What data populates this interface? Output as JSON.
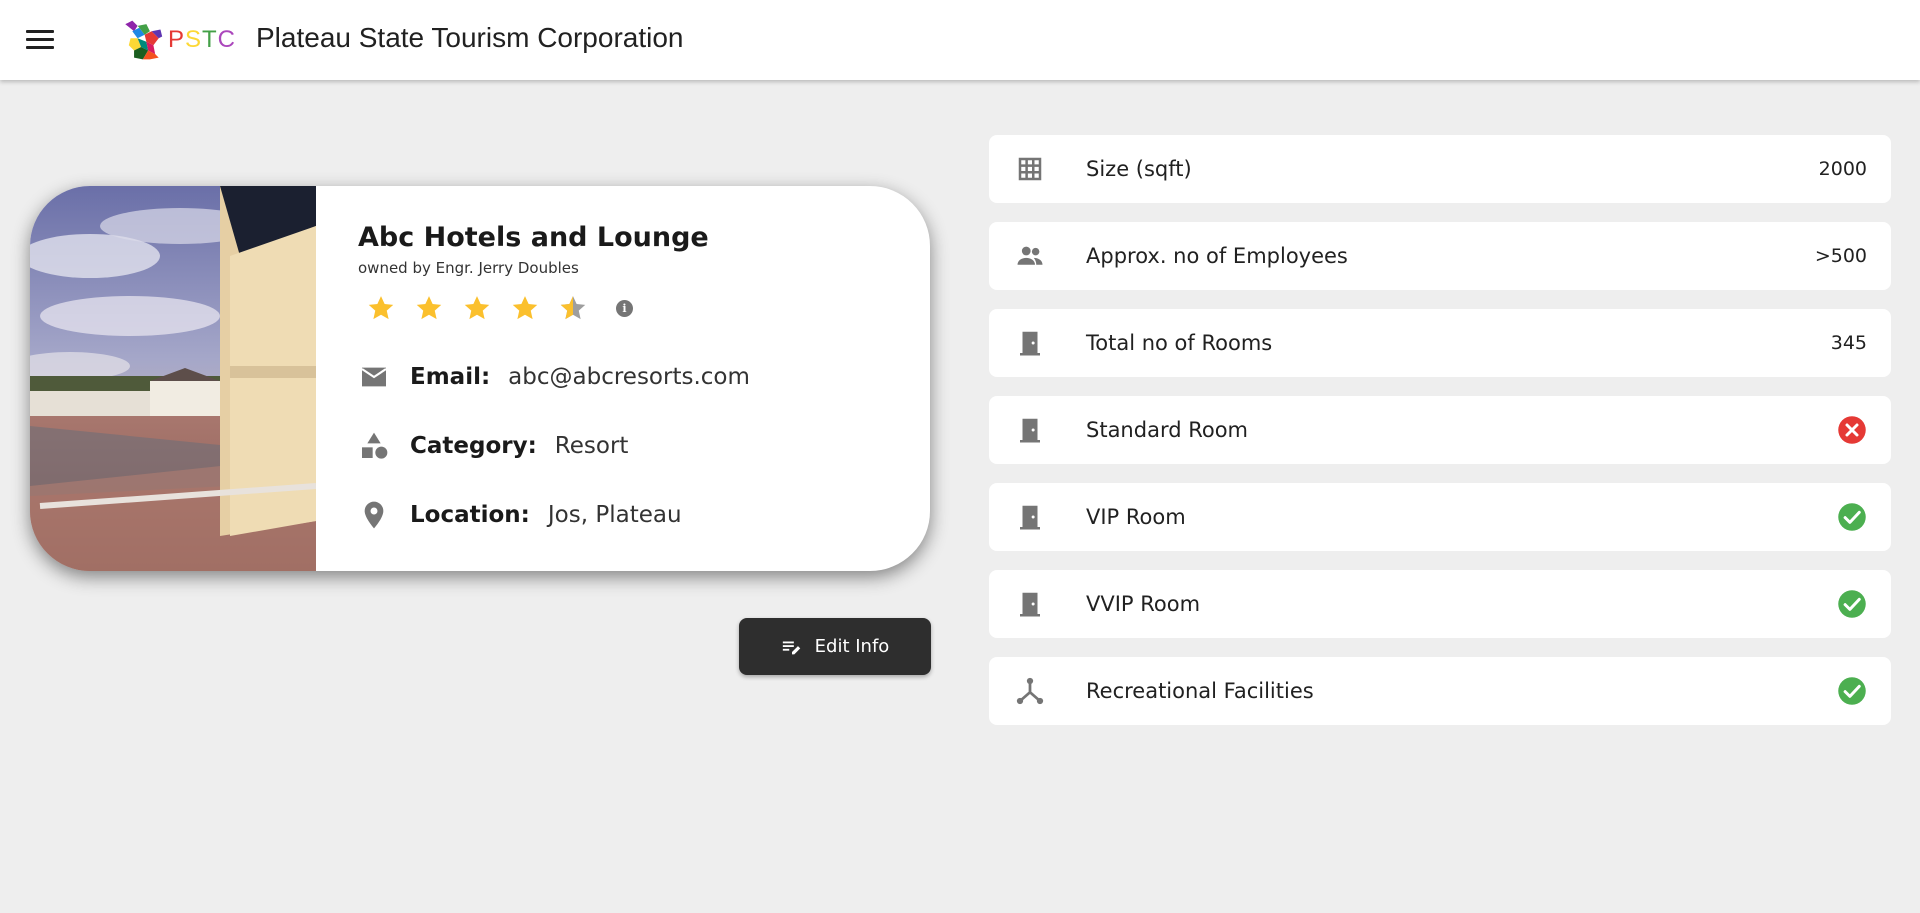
{
  "header": {
    "logo_letters": [
      "P",
      "S",
      "T",
      "C"
    ],
    "title": "Plateau State Tourism Corporation"
  },
  "hotel": {
    "name": "Abc Hotels and Lounge",
    "owner": "owned by Engr. Jerry Doubles",
    "rating": 4.5,
    "rating_max": 5,
    "email_label": "Email:",
    "email": "abc@abcresorts.com",
    "category_label": "Category:",
    "category": "Resort",
    "location_label": "Location:",
    "location": "Jos, Plateau"
  },
  "actions": {
    "edit_label": "Edit Info"
  },
  "features": [
    {
      "icon": "grid-icon",
      "label": "Size (sqft)",
      "value": "2000"
    },
    {
      "icon": "people-icon",
      "label": "Approx. no of Employees",
      "value": ">500"
    },
    {
      "icon": "door-icon",
      "label": "Total no of Rooms",
      "value": "345"
    },
    {
      "icon": "door-icon",
      "label": "Standard Room",
      "status": "unavailable"
    },
    {
      "icon": "door-icon",
      "label": "VIP Room",
      "status": "available"
    },
    {
      "icon": "door-icon",
      "label": "VVIP Room",
      "status": "available"
    },
    {
      "icon": "hub-icon",
      "label": "Recreational Facilities",
      "status": "available"
    }
  ],
  "colors": {
    "star": "#fbc02d",
    "available": "#4caf50",
    "unavailable": "#e53935",
    "button": "#2e2e2e"
  }
}
